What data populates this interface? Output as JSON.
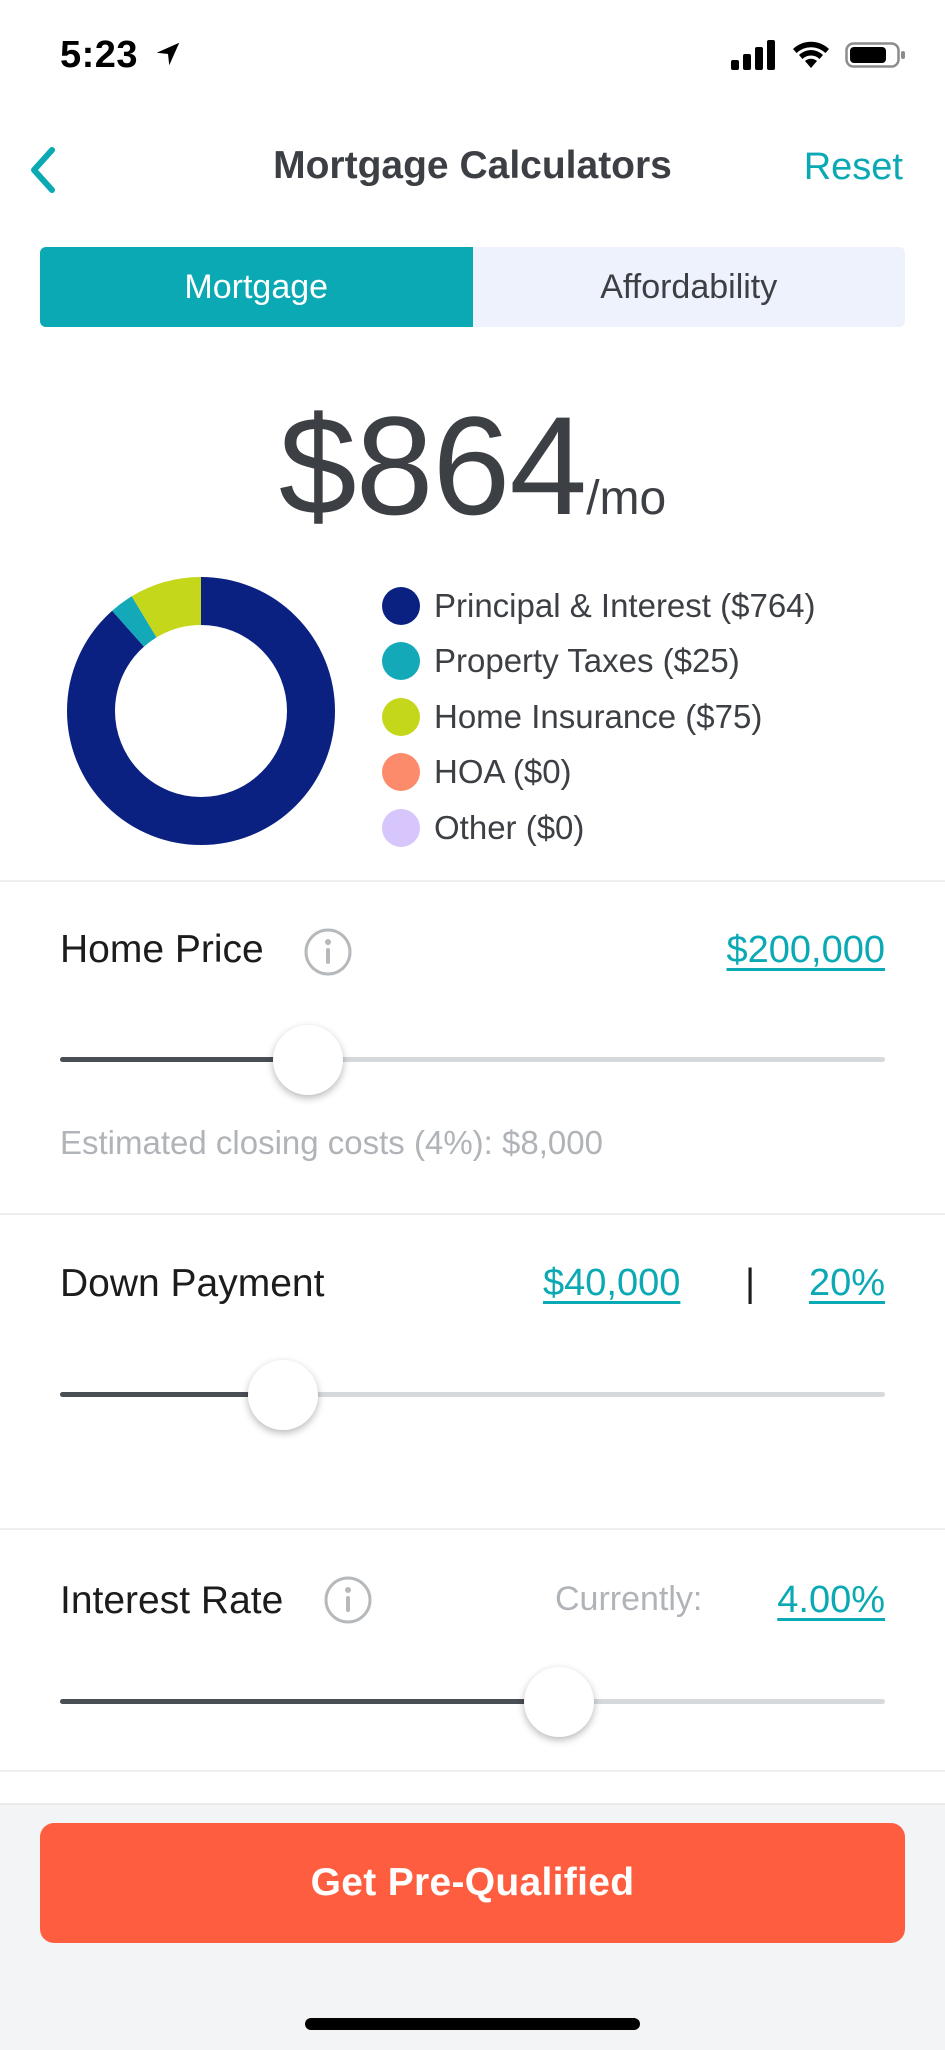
{
  "status": {
    "time": "5:23"
  },
  "nav": {
    "title": "Mortgage Calculators",
    "reset_label": "Reset"
  },
  "tabs": [
    {
      "label": "Mortgage",
      "active": true
    },
    {
      "label": "Affordability",
      "active": false
    }
  ],
  "payment": {
    "amount": "$864",
    "unit": "/mo"
  },
  "breakdown": [
    {
      "label": "Principal & Interest ($764)",
      "value": 764,
      "color": "#0b2182"
    },
    {
      "label": "Property Taxes ($25)",
      "value": 25,
      "color": "#13a9b9"
    },
    {
      "label": "Home Insurance ($75)",
      "value": 75,
      "color": "#c4d71a"
    },
    {
      "label": "HOA ($0)",
      "value": 0,
      "color": "#fb8b6a"
    },
    {
      "label": "Other ($0)",
      "value": 0,
      "color": "#d6c6fb"
    }
  ],
  "home_price": {
    "label": "Home Price",
    "value": "$200,000",
    "slider_fraction": 0.3,
    "closing_costs": "Estimated closing costs (4%): $8,000"
  },
  "down_payment": {
    "label": "Down Payment",
    "amount": "$40,000",
    "separator": "|",
    "percent": "20%",
    "slider_fraction": 0.27
  },
  "interest_rate": {
    "label": "Interest Rate",
    "currently_label": "Currently:",
    "value": "4.00%",
    "slider_fraction": 0.605
  },
  "cta": {
    "label": "Get Pre-Qualified"
  },
  "colors": {
    "accent": "#0aa9b4",
    "cta": "#fe5e3f"
  },
  "icons": [
    "location-arrow-icon",
    "signal-icon",
    "wifi-icon",
    "battery-icon",
    "chevron-left-icon",
    "info-icon"
  ]
}
